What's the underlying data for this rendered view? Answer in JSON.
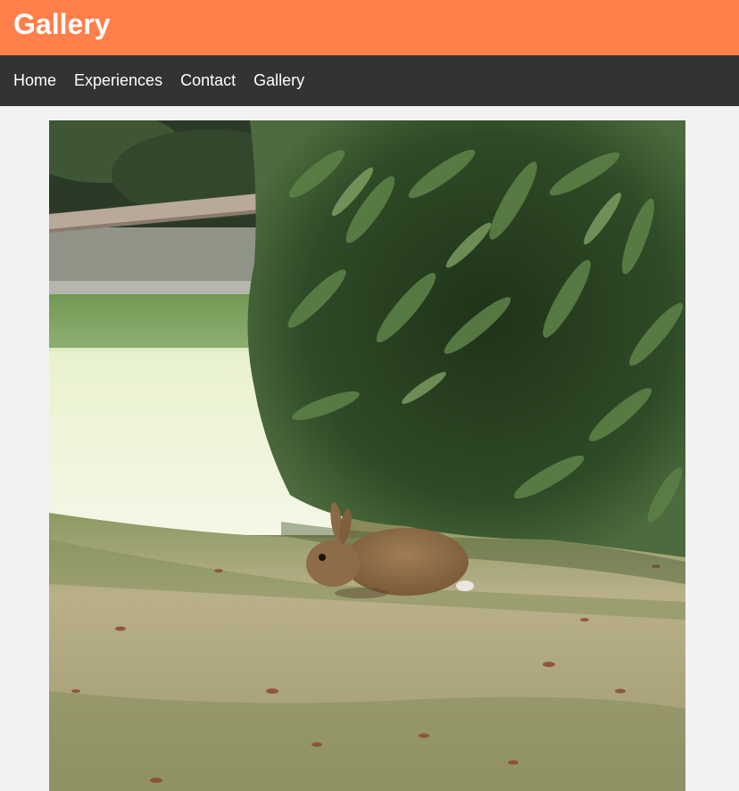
{
  "header": {
    "title": "Gallery",
    "background_color": "#ff7f4a",
    "text_color": "#ffffff"
  },
  "nav": {
    "background_color": "#333333",
    "items": [
      {
        "label": "Home"
      },
      {
        "label": "Experiences"
      },
      {
        "label": "Contact"
      },
      {
        "label": "Gallery"
      }
    ]
  },
  "gallery": {
    "photo_subject": "rabbit-photo"
  },
  "page": {
    "background_color": "#f2f2f2"
  }
}
